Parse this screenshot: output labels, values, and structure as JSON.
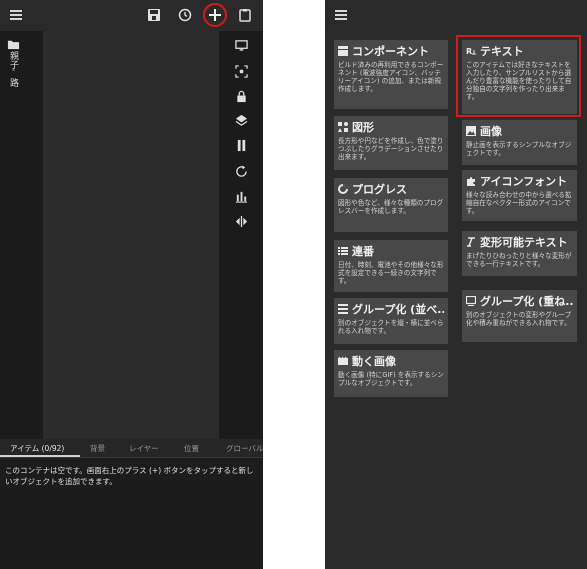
{
  "left_screen": {
    "toolbar": {
      "menu_icon": "hamburger-icon",
      "save_icon": "save-icon",
      "history_icon": "history-icon",
      "add_icon": "plus-icon",
      "clipboard_icon": "clipboard-icon",
      "highlight_color": "#d51a1a"
    },
    "left_panel": {
      "folder_icon": "folder-icon",
      "label": "親子ﾞ路"
    },
    "right_tools": [
      "monitor-icon",
      "target-icon",
      "lock-icon",
      "layers-icon",
      "pause-icon",
      "rotate-icon",
      "bar-chart-icon",
      "split-icon"
    ],
    "tabs": [
      "アイテム (0/92)",
      "背景",
      "レイヤー",
      "位置",
      "グローバル"
    ],
    "empty_message": "このコンテナは空です。画面右上のプラス (+) ボタンをタップすると新しいオブジェクトを追加できます。"
  },
  "right_screen": {
    "menu_icon": "hamburger-icon",
    "cards": [
      {
        "title": "コンポーネント",
        "icon": "component-icon",
        "desc": "ビルド済みの再利用できるコンポーネント (電波強度アイコン、バッテリーアイコン) の追加、または新規作成します。"
      },
      {
        "title": "テキスト",
        "icon": "text-icon",
        "desc": "このアイテムでは好きなテキストを入力したり、サンプルリストから選んだり豊富な機能を使ったりして自分独自の文字列を作ったり出来ます。"
      },
      {
        "title": "図形",
        "icon": "shapes-icon",
        "desc": "長方形や円などを作成し、色で塗りつぶしたりグラデーションさせたり出来ます。"
      },
      {
        "title": "画像",
        "icon": "image-icon",
        "desc": "静止画を表示するシンプルなオブジェクトです。"
      },
      {
        "title": "プログレス",
        "icon": "progress-icon",
        "desc": "図形や色など、様々な種類のプログレスバーを作成します。"
      },
      {
        "title": "アイコンフォント",
        "icon": "puzzle-icon",
        "desc": "様々な読み合わせの中から選べる拡縮自在なベクター形式のアイコンです。"
      },
      {
        "title": "連番",
        "icon": "list-icon",
        "desc": "日付、時刻、電池やその他様々な形式を設定できる一続きの文字列です。"
      },
      {
        "title": "変形可能テキスト",
        "icon": "transform-text-icon",
        "desc": "まげたりひねったりと様々な変形ができる一行テキストです。"
      },
      {
        "title": "グループ化 (並べ...",
        "icon": "stack-icon",
        "desc": "別のオブジェクトを縦・横に並べられる入れ物です。"
      },
      {
        "title": "グループ化 (重ね...",
        "icon": "overlap-icon",
        "desc": "別のオブジェクトの変形やグループ化や積み重ねができる入れ物です。"
      },
      {
        "title": "動く画像",
        "icon": "gif-icon",
        "desc": "動く画像 (特にGIF) を表示するシンプルなオブジェクトです。"
      }
    ]
  }
}
